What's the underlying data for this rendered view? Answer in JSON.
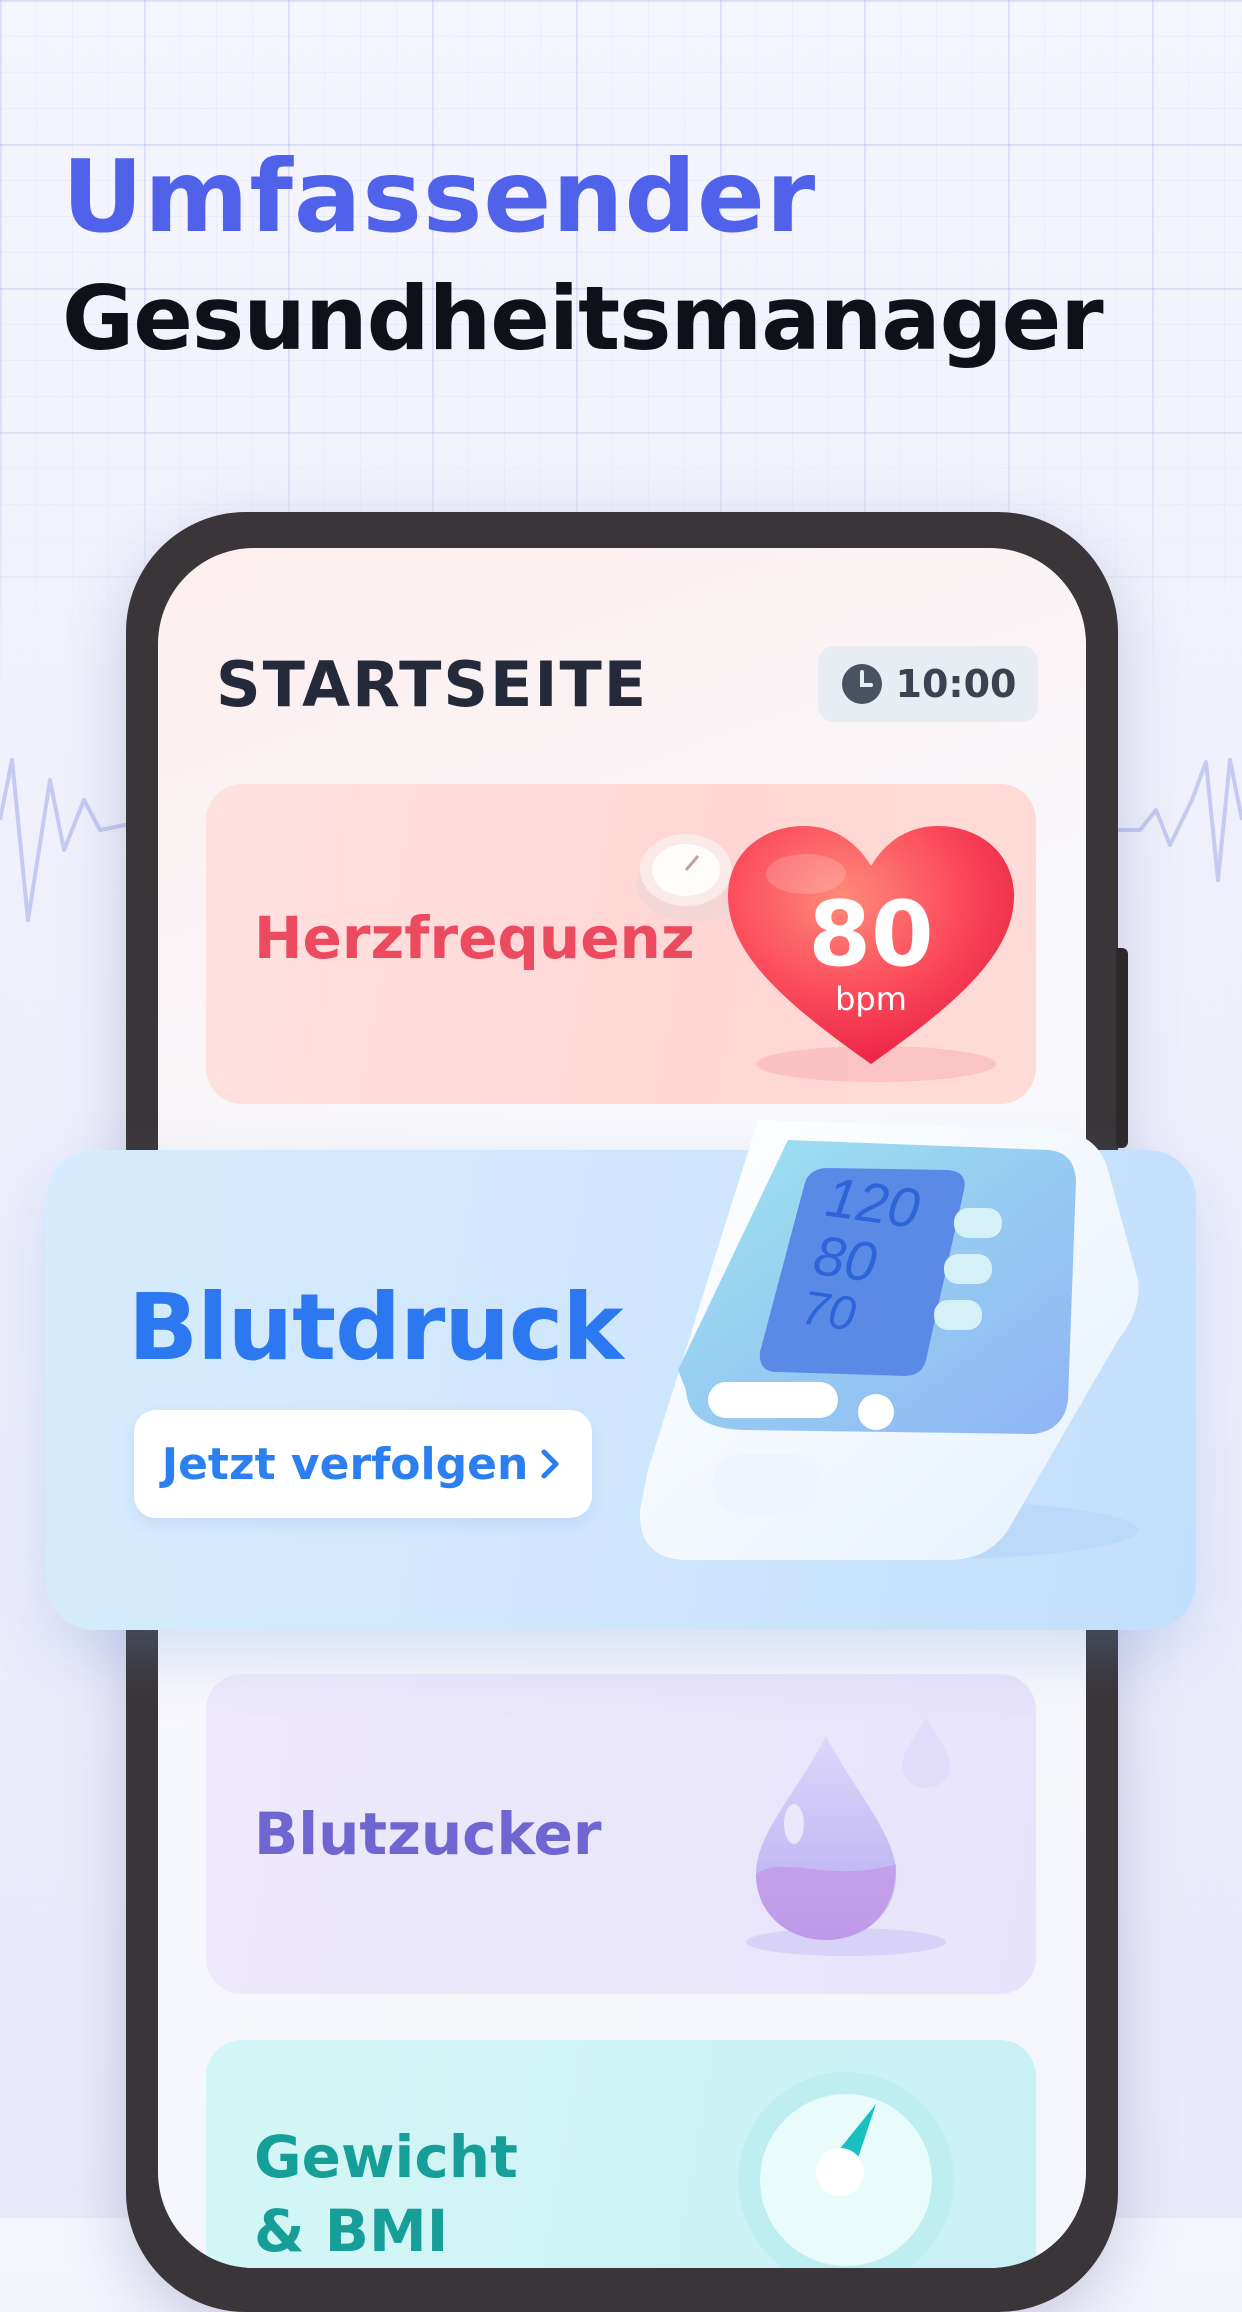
{
  "headline": {
    "line1": "Umfassender",
    "line2": "Gesundheitsmanager"
  },
  "screen": {
    "title": "STARTSEITE",
    "time": "10:00",
    "time_icon": "clock-icon"
  },
  "cards": {
    "heart_rate": {
      "label": "Herzfrequenz",
      "value": "80",
      "unit": "bpm",
      "icon": "heart-icon"
    },
    "blood_pressure": {
      "label": "Blutdruck",
      "button_label": "Jetzt verfolgen",
      "button_icon": "chevron-right-icon",
      "monitor_readings": [
        "120",
        "80",
        "70"
      ],
      "icon": "blood-pressure-monitor-icon"
    },
    "blood_sugar": {
      "label": "Blutzucker",
      "icon": "drop-icon"
    },
    "weight": {
      "label_line1": "Gewicht",
      "label_line2": "& BMI",
      "icon": "scale-gauge-icon"
    }
  },
  "colors": {
    "headline_accent": "#5061ea",
    "heart_label": "#ec4a5e",
    "pressure_title": "#2b78f0",
    "sugar_label": "#7066d2",
    "weight_label": "#169e98"
  }
}
